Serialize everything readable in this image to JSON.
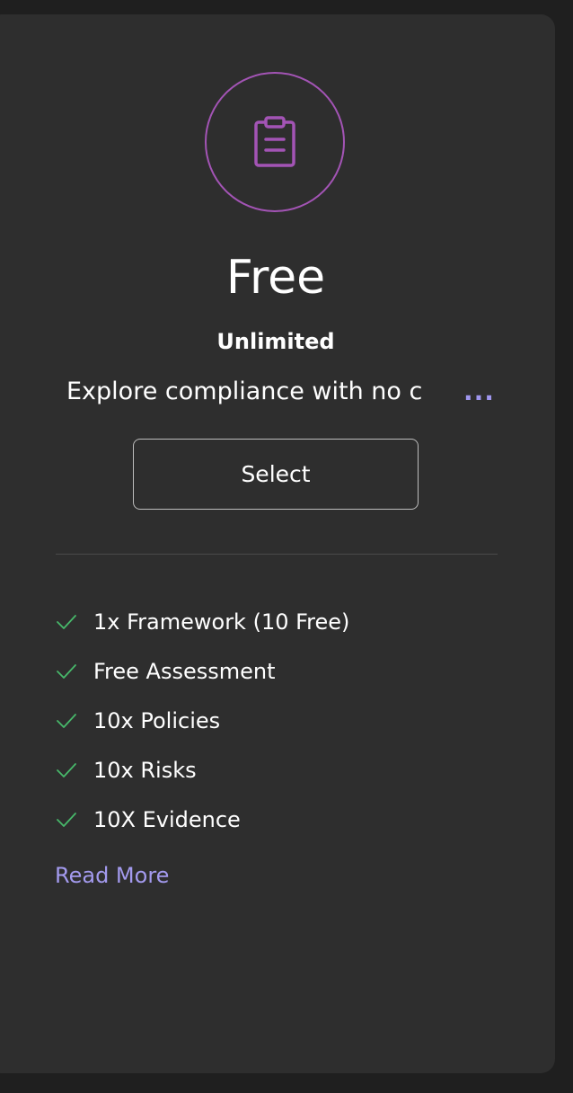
{
  "plan": {
    "title": "Free",
    "subtitle": "Unlimited",
    "description": "Explore compliance with no c",
    "more_indicator": "...",
    "icon": "clipboard-icon",
    "select_label": "Select",
    "features": [
      "1x Framework (10 Free)",
      "Free Assessment",
      "10x Policies",
      "10x Risks",
      "10X Evidence"
    ],
    "read_more_label": "Read More"
  },
  "colors": {
    "background": "#1f1f1f",
    "card": "#2e2e2e",
    "icon_accent": "#a354b5",
    "check_accent": "#47b86a",
    "link": "#a39aee"
  }
}
